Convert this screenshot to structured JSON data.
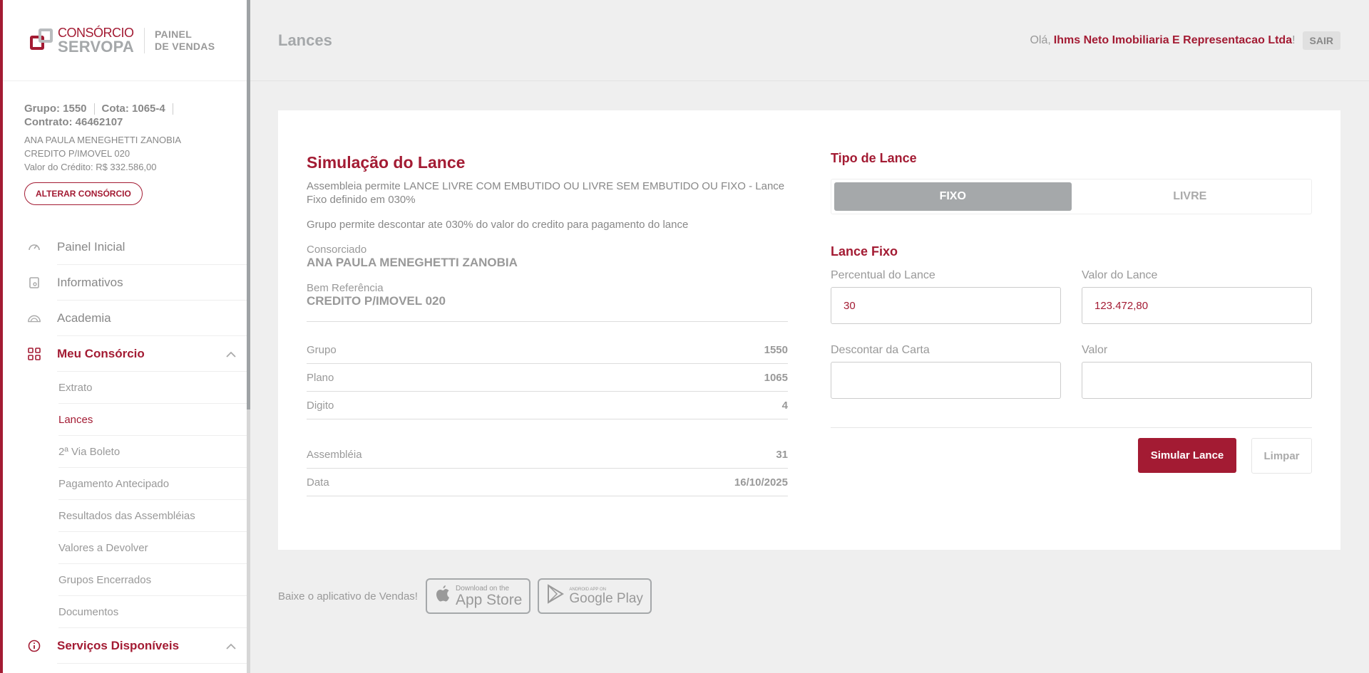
{
  "logo": {
    "line1": "CONSÓRCIO",
    "line2": "SERVOPA",
    "panel1": "PAINEL",
    "panel2": "DE VENDAS"
  },
  "account": {
    "grupo": "Grupo: 1550",
    "cota": "Cota: 1065-4",
    "contrato": "Contrato: 46462107",
    "name": "ANA PAULA MENEGHETTI ZANOBIA",
    "product": "CREDITO P/IMOVEL 020",
    "credit": "Valor do Crédito: R$ 332.586,00",
    "change_button": "ALTERAR CONSÓRCIO"
  },
  "nav": {
    "painel": "Painel Inicial",
    "informativos": "Informativos",
    "academia": "Academia",
    "meu_consorcio": "Meu Consórcio",
    "sub": [
      "Extrato",
      "Lances",
      "2ª Via Boleto",
      "Pagamento Antecipado",
      "Resultados das Assembléias",
      "Valores a Devolver",
      "Grupos Encerrados",
      "Documentos"
    ],
    "servicos": "Serviços Disponíveis"
  },
  "header": {
    "title": "Lances",
    "greeting": "Olá,",
    "user": "Ihms Neto Imobiliaria E Representacao Ltda",
    "exclaim": "!",
    "logout": "SAIR"
  },
  "simulation": {
    "title": "Simulação do Lance",
    "desc1": "Assembleia permite LANCE LIVRE COM EMBUTIDO OU LIVRE SEM EMBUTIDO OU FIXO - Lance Fixo definido em 030%",
    "desc2": "Grupo permite descontar ate 030% do valor do credito para pagamento do lance",
    "consorciado_label": "Consorciado",
    "consorciado_value": "ANA PAULA MENEGHETTI ZANOBIA",
    "bem_label": "Bem Referência",
    "bem_value": "CREDITO P/IMOVEL 020",
    "rows": [
      {
        "label": "Grupo",
        "value": "1550"
      },
      {
        "label": "Plano",
        "value": "1065"
      },
      {
        "label": "Digito",
        "value": "4"
      }
    ],
    "rows2": [
      {
        "label": "Assembléia",
        "value": "31"
      },
      {
        "label": "Data",
        "value": "16/10/2025"
      }
    ]
  },
  "bid": {
    "type_title": "Tipo de Lance",
    "tab_fixo": "FIXO",
    "tab_livre": "LIVRE",
    "fixed_title": "Lance Fixo",
    "percent_label": "Percentual do Lance",
    "percent_value": "30",
    "value_label": "Valor do Lance",
    "value_value": "123.472,80",
    "discount_label": "Descontar da Carta",
    "discount_value": "",
    "valor_label": "Valor",
    "valor_value": "",
    "simulate": "Simular Lance",
    "clear": "Limpar"
  },
  "footer": {
    "text": "Baixe o aplicativo de Vendas!",
    "appstore_small": "Download on the",
    "appstore_big": "App Store",
    "gplay_small": "ANDROID APP ON",
    "gplay_big": "Google Play"
  },
  "colors": {
    "accent": "#a31b33",
    "muted": "#a5a8aa",
    "background": "#efefef"
  },
  "icons": [
    "speedometer-icon",
    "document-icon",
    "academy-icon",
    "grid-icon",
    "info-icon",
    "chevron-up-icon",
    "apple-icon",
    "play-icon"
  ]
}
